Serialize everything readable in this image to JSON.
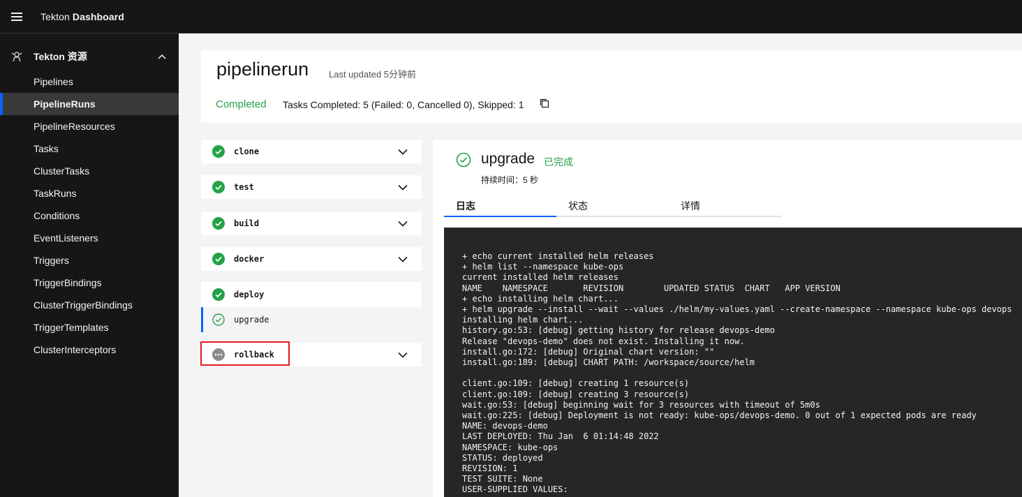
{
  "header": {
    "brand_prefix": "Tekton",
    "brand_bold": "Dashboard"
  },
  "sidebar": {
    "group_label": "Tekton 资源",
    "items": [
      {
        "label": "Pipelines"
      },
      {
        "label": "PipelineRuns",
        "active": true
      },
      {
        "label": "PipelineResources"
      },
      {
        "label": "Tasks"
      },
      {
        "label": "ClusterTasks"
      },
      {
        "label": "TaskRuns"
      },
      {
        "label": "Conditions"
      },
      {
        "label": "EventListeners"
      },
      {
        "label": "Triggers"
      },
      {
        "label": "TriggerBindings"
      },
      {
        "label": "ClusterTriggerBindings"
      },
      {
        "label": "TriggerTemplates"
      },
      {
        "label": "ClusterInterceptors"
      }
    ]
  },
  "run": {
    "title": "pipelinerun",
    "last_updated": "Last updated 5分钟前",
    "status": "Completed",
    "tasks_summary": "Tasks Completed: 5 (Failed: 0, Cancelled 0), Skipped: 1"
  },
  "tasks": [
    {
      "label": "clone",
      "status": "succeeded"
    },
    {
      "label": "test",
      "status": "succeeded"
    },
    {
      "label": "build",
      "status": "succeeded"
    },
    {
      "label": "docker",
      "status": "succeeded"
    },
    {
      "label": "deploy",
      "status": "succeeded",
      "expanded": true,
      "steps": [
        {
          "label": "upgrade",
          "status": "succeeded"
        }
      ]
    },
    {
      "label": "rollback",
      "status": "skipped"
    }
  ],
  "colors": {
    "accent": "#0f62fe",
    "success": "#24a148",
    "highlight": "#e11d1d",
    "skipped": "#8d8d8d"
  },
  "detail": {
    "step_name": "upgrade",
    "step_status": "已完成",
    "duration": "持续时间：5 秒",
    "tabs": [
      "日志",
      "状态",
      "详情"
    ],
    "log_lines": [
      "+ echo current installed helm releases",
      "+ helm list --namespace kube-ops",
      "current installed helm releases",
      "NAME    NAMESPACE       REVISION        UPDATED STATUS  CHART   APP VERSION",
      "+ echo installing helm chart...",
      "+ helm upgrade --install --wait --values ./helm/my-values.yaml --create-namespace --namespace kube-ops devops",
      "installing helm chart...",
      "history.go:53: [debug] getting history for release devops-demo",
      "Release \"devops-demo\" does not exist. Installing it now.",
      "install.go:172: [debug] Original chart version: \"\"",
      "install.go:189: [debug] CHART PATH: /workspace/source/helm",
      "",
      "client.go:109: [debug] creating 1 resource(s)",
      "client.go:109: [debug] creating 3 resource(s)",
      "wait.go:53: [debug] beginning wait for 3 resources with timeout of 5m0s",
      "wait.go:225: [debug] Deployment is not ready: kube-ops/devops-demo. 0 out of 1 expected pods are ready",
      "NAME: devops-demo",
      "LAST DEPLOYED: Thu Jan  6 01:14:48 2022",
      "NAMESPACE: kube-ops",
      "STATUS: deployed",
      "REVISION: 1",
      "TEST SUITE: None",
      "USER-SUPPLIED VALUES:"
    ]
  }
}
